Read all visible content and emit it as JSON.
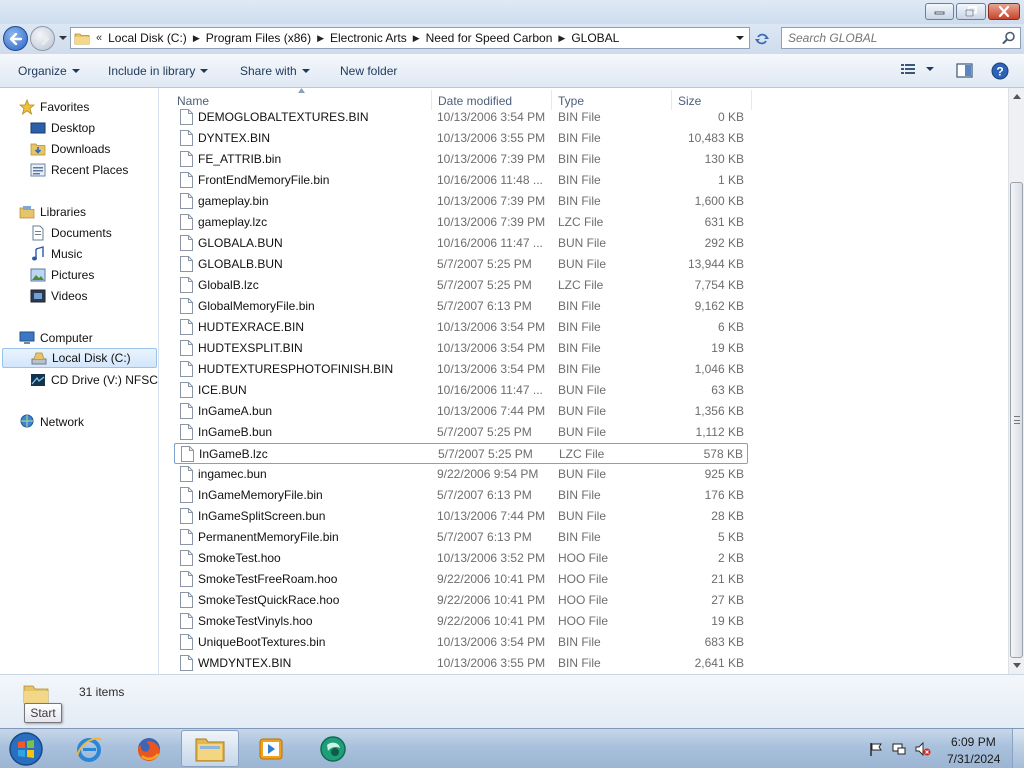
{
  "window": {
    "minimize_icon": "minimize-icon",
    "maximize_icon": "maximize-icon",
    "close_icon": "close-icon"
  },
  "address_bar": {
    "overflow": "«",
    "breadcrumbs": [
      "Local Disk (C:)",
      "Program Files (x86)",
      "Electronic Arts",
      "Need for Speed Carbon",
      "GLOBAL"
    ]
  },
  "search": {
    "placeholder": "Search GLOBAL"
  },
  "command_bar": {
    "organize": "Organize",
    "include_in_library": "Include in library",
    "share_with": "Share with",
    "new_folder": "New folder"
  },
  "nav_pane": {
    "favorites": {
      "label": "Favorites",
      "items": [
        "Desktop",
        "Downloads",
        "Recent Places"
      ]
    },
    "libraries": {
      "label": "Libraries",
      "items": [
        "Documents",
        "Music",
        "Pictures",
        "Videos"
      ]
    },
    "computer": {
      "label": "Computer",
      "items": [
        "Local Disk (C:)",
        "CD Drive (V:) NFSCA"
      ],
      "selected": "Local Disk (C:)"
    },
    "network": {
      "label": "Network"
    }
  },
  "columns": {
    "name": "Name",
    "date_modified": "Date modified",
    "type": "Type",
    "size": "Size"
  },
  "files": [
    {
      "name": "DEMOGLOBALTEXTURES.BIN",
      "date": "10/13/2006 3:54 PM",
      "type": "BIN File",
      "size": "0 KB"
    },
    {
      "name": "DYNTEX.BIN",
      "date": "10/13/2006 3:55 PM",
      "type": "BIN File",
      "size": "10,483 KB"
    },
    {
      "name": "FE_ATTRIB.bin",
      "date": "10/13/2006 7:39 PM",
      "type": "BIN File",
      "size": "130 KB"
    },
    {
      "name": "FrontEndMemoryFile.bin",
      "date": "10/16/2006 11:48 ...",
      "type": "BIN File",
      "size": "1 KB"
    },
    {
      "name": "gameplay.bin",
      "date": "10/13/2006 7:39 PM",
      "type": "BIN File",
      "size": "1,600 KB"
    },
    {
      "name": "gameplay.lzc",
      "date": "10/13/2006 7:39 PM",
      "type": "LZC File",
      "size": "631 KB"
    },
    {
      "name": "GLOBALA.BUN",
      "date": "10/16/2006 11:47 ...",
      "type": "BUN File",
      "size": "292 KB"
    },
    {
      "name": "GLOBALB.BUN",
      "date": "5/7/2007 5:25 PM",
      "type": "BUN File",
      "size": "13,944 KB"
    },
    {
      "name": "GlobalB.lzc",
      "date": "5/7/2007 5:25 PM",
      "type": "LZC File",
      "size": "7,754 KB"
    },
    {
      "name": "GlobalMemoryFile.bin",
      "date": "5/7/2007 6:13 PM",
      "type": "BIN File",
      "size": "9,162 KB"
    },
    {
      "name": "HUDTEXRACE.BIN",
      "date": "10/13/2006 3:54 PM",
      "type": "BIN File",
      "size": "6 KB"
    },
    {
      "name": "HUDTEXSPLIT.BIN",
      "date": "10/13/2006 3:54 PM",
      "type": "BIN File",
      "size": "19 KB"
    },
    {
      "name": "HUDTEXTURESPHOTOFINISH.BIN",
      "date": "10/13/2006 3:54 PM",
      "type": "BIN File",
      "size": "1,046 KB"
    },
    {
      "name": "ICE.BUN",
      "date": "10/16/2006 11:47 ...",
      "type": "BUN File",
      "size": "63 KB"
    },
    {
      "name": "InGameA.bun",
      "date": "10/13/2006 7:44 PM",
      "type": "BUN File",
      "size": "1,356 KB"
    },
    {
      "name": "InGameB.bun",
      "date": "5/7/2007 5:25 PM",
      "type": "BUN File",
      "size": "1,112 KB"
    },
    {
      "name": "InGameB.lzc",
      "date": "5/7/2007 5:25 PM",
      "type": "LZC File",
      "size": "578 KB"
    },
    {
      "name": "ingamec.bun",
      "date": "9/22/2006 9:54 PM",
      "type": "BUN File",
      "size": "925 KB"
    },
    {
      "name": "InGameMemoryFile.bin",
      "date": "5/7/2007 6:13 PM",
      "type": "BIN File",
      "size": "176 KB"
    },
    {
      "name": "InGameSplitScreen.bun",
      "date": "10/13/2006 7:44 PM",
      "type": "BUN File",
      "size": "28 KB"
    },
    {
      "name": "PermanentMemoryFile.bin",
      "date": "5/7/2007 6:13 PM",
      "type": "BIN File",
      "size": "5 KB"
    },
    {
      "name": "SmokeTest.hoo",
      "date": "10/13/2006 3:52 PM",
      "type": "HOO File",
      "size": "2 KB"
    },
    {
      "name": "SmokeTestFreeRoam.hoo",
      "date": "9/22/2006 10:41 PM",
      "type": "HOO File",
      "size": "21 KB"
    },
    {
      "name": "SmokeTestQuickRace.hoo",
      "date": "9/22/2006 10:41 PM",
      "type": "HOO File",
      "size": "27 KB"
    },
    {
      "name": "SmokeTestVinyls.hoo",
      "date": "9/22/2006 10:41 PM",
      "type": "HOO File",
      "size": "19 KB"
    },
    {
      "name": "UniqueBootTextures.bin",
      "date": "10/13/2006 3:54 PM",
      "type": "BIN File",
      "size": "683 KB"
    },
    {
      "name": "WMDYNTEX.BIN",
      "date": "10/13/2006 3:55 PM",
      "type": "BIN File",
      "size": "2,641 KB"
    }
  ],
  "focused_file": "InGameB.lzc",
  "details_pane": {
    "items_count": "31 items"
  },
  "tooltip": {
    "text": "Start"
  },
  "taskbar": {
    "pinned": [
      "internet-explorer-icon",
      "firefox-icon",
      "windows-explorer-icon",
      "media-player-icon",
      "app-icon"
    ],
    "active": "windows-explorer-icon",
    "clock": {
      "time": "6:09 PM",
      "date": "7/31/2024"
    }
  },
  "colors": {
    "accent": "#1e395b",
    "selection_border": "#7da2ce",
    "taskbar": "#a9c1dc"
  }
}
